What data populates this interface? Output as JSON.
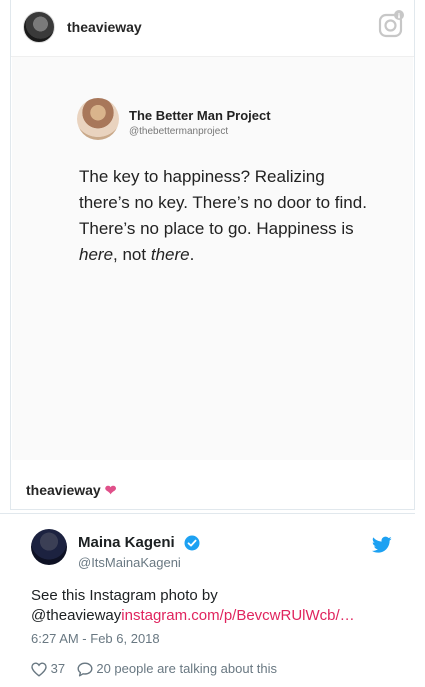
{
  "instagram": {
    "username": "theavieway",
    "caption_user": "theavieway",
    "caption_heart": "❤",
    "quote": {
      "name": "The Better Man Project",
      "handle": "@thebettermanproject",
      "line1": "The key to happiness? Realizing",
      "line2": "there’s no key. There’s no door to find.",
      "line3": "There’s no place to go. Happiness is",
      "line4_a": "here",
      "line4_b": ", not ",
      "line4_c": "there",
      "line4_d": "."
    }
  },
  "tweet": {
    "name": "Maina Kageni",
    "handle": "@ItsMainaKageni",
    "text_line1": "See this Instagram photo by",
    "text_mention": "@theavieway",
    "text_link": "instagram.com/p/BevcwRUlWcb/…",
    "timestamp": "6:27 AM - Feb 6, 2018",
    "likes": "37",
    "replies_text": "20 people are talking about this"
  },
  "colors": {
    "link": "#e0245e",
    "verified": "#1da1f2",
    "twitter_bird": "#1da1f2",
    "heart": "#e0508a"
  },
  "icons": [
    "instagram-icon",
    "verified-badge-icon",
    "twitter-bird-icon",
    "like-heart-icon",
    "reply-icon"
  ]
}
